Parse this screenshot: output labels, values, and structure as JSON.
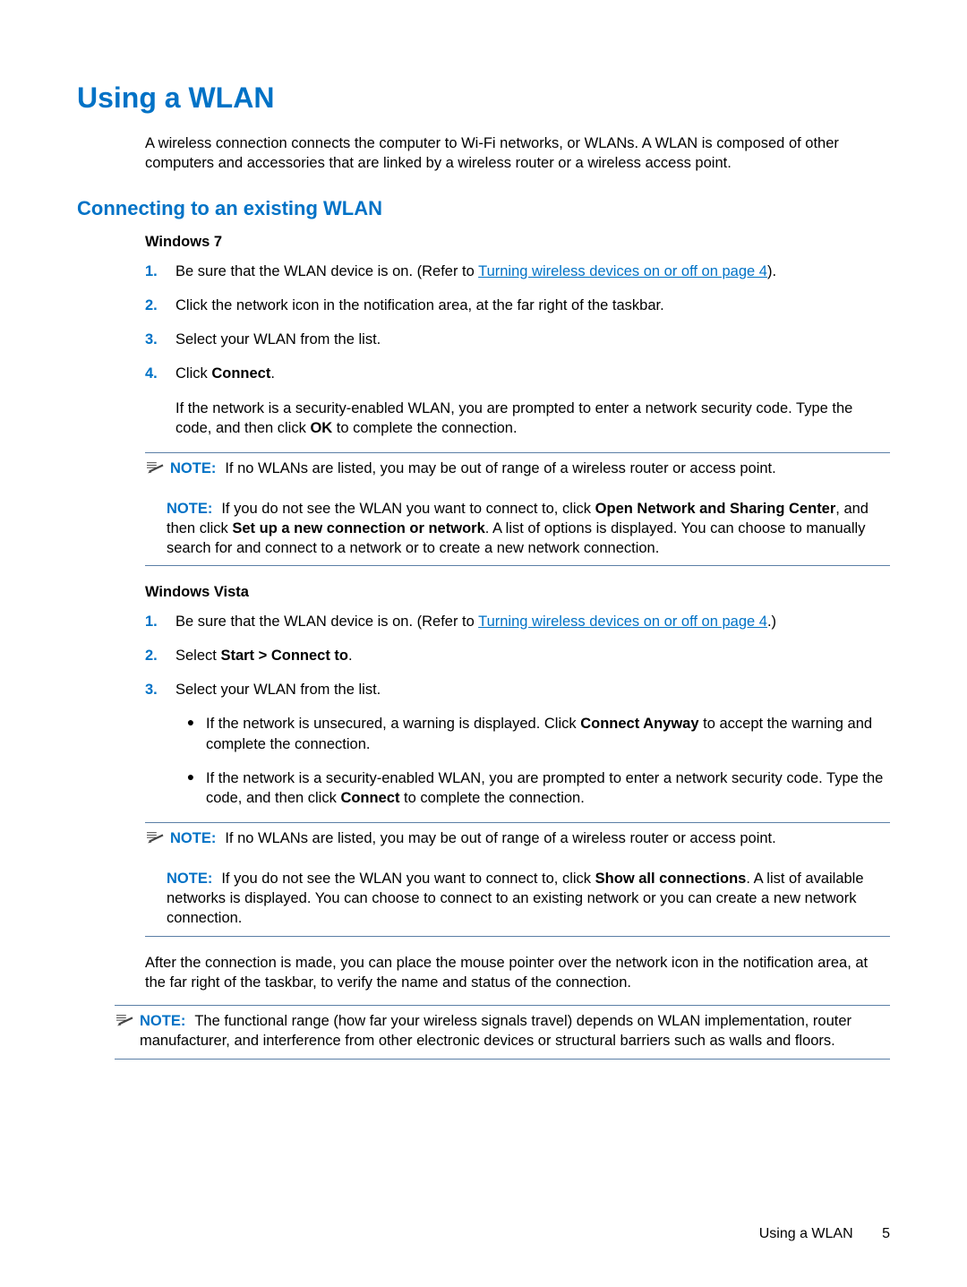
{
  "h1": "Using a WLAN",
  "intro": "A wireless connection connects the computer to Wi-Fi networks, or WLANs. A WLAN is composed of other computers and accessories that are linked by a wireless router or a wireless access point.",
  "h2": "Connecting to an existing WLAN",
  "win7": {
    "heading": "Windows 7",
    "steps": {
      "s1a": "Be sure that the WLAN device is on. (Refer to ",
      "s1link": "Turning wireless devices on or off on page 4",
      "s1b": ").",
      "s2": "Click the network icon in the notification area, at the far right of the taskbar.",
      "s3": "Select your WLAN from the list.",
      "s4a": "Click ",
      "s4b": "Connect",
      "s4c": ".",
      "s4_cont_a": "If the network is a security-enabled WLAN, you are prompted to enter a network security code. Type the code, and then click ",
      "s4_cont_b": "OK",
      "s4_cont_c": " to complete the connection."
    },
    "note1": "If no WLANs are listed, you may be out of range of a wireless router or access point.",
    "note2": {
      "a": "If you do not see the WLAN you want to connect to, click ",
      "b": "Open Network and Sharing Center",
      "c": ", and then click ",
      "d": "Set up a new connection or network",
      "e": ". A list of options is displayed. You can choose to manually search for and connect to a network or to create a new network connection."
    }
  },
  "vista": {
    "heading": "Windows Vista",
    "steps": {
      "s1a": "Be sure that the WLAN device is on. (Refer to ",
      "s1link": "Turning wireless devices on or off on page 4",
      "s1b": ".)",
      "s2a": "Select ",
      "s2b": "Start > Connect to",
      "s2c": ".",
      "s3": "Select your WLAN from the list.",
      "b1a": "If the network is unsecured, a warning is displayed. Click ",
      "b1b": "Connect Anyway",
      "b1c": " to accept the warning and complete the connection.",
      "b2a": "If the network is a security-enabled WLAN, you are prompted to enter a network security code. Type the code, and then click ",
      "b2b": "Connect",
      "b2c": " to complete the connection."
    },
    "note1": "If no WLANs are listed, you may be out of range of a wireless router or access point.",
    "note2": {
      "a": "If you do not see the WLAN you want to connect to, click ",
      "b": "Show all connections",
      "c": ". A list of available networks is displayed. You can choose to connect to an existing network or you can create a new network connection."
    }
  },
  "after": "After the connection is made, you can place the mouse pointer over the network icon in the notification area, at the far right of the taskbar, to verify the name and status of the connection.",
  "finalNote": "The functional range (how far your wireless signals travel) depends on WLAN implementation, router manufacturer, and interference from other electronic devices or structural barriers such as walls and floors.",
  "noteLabel": "NOTE:",
  "nums": {
    "n1": "1.",
    "n2": "2.",
    "n3": "3.",
    "n4": "4."
  },
  "bullet": "●",
  "footer": {
    "title": "Using a WLAN",
    "page": "5"
  }
}
